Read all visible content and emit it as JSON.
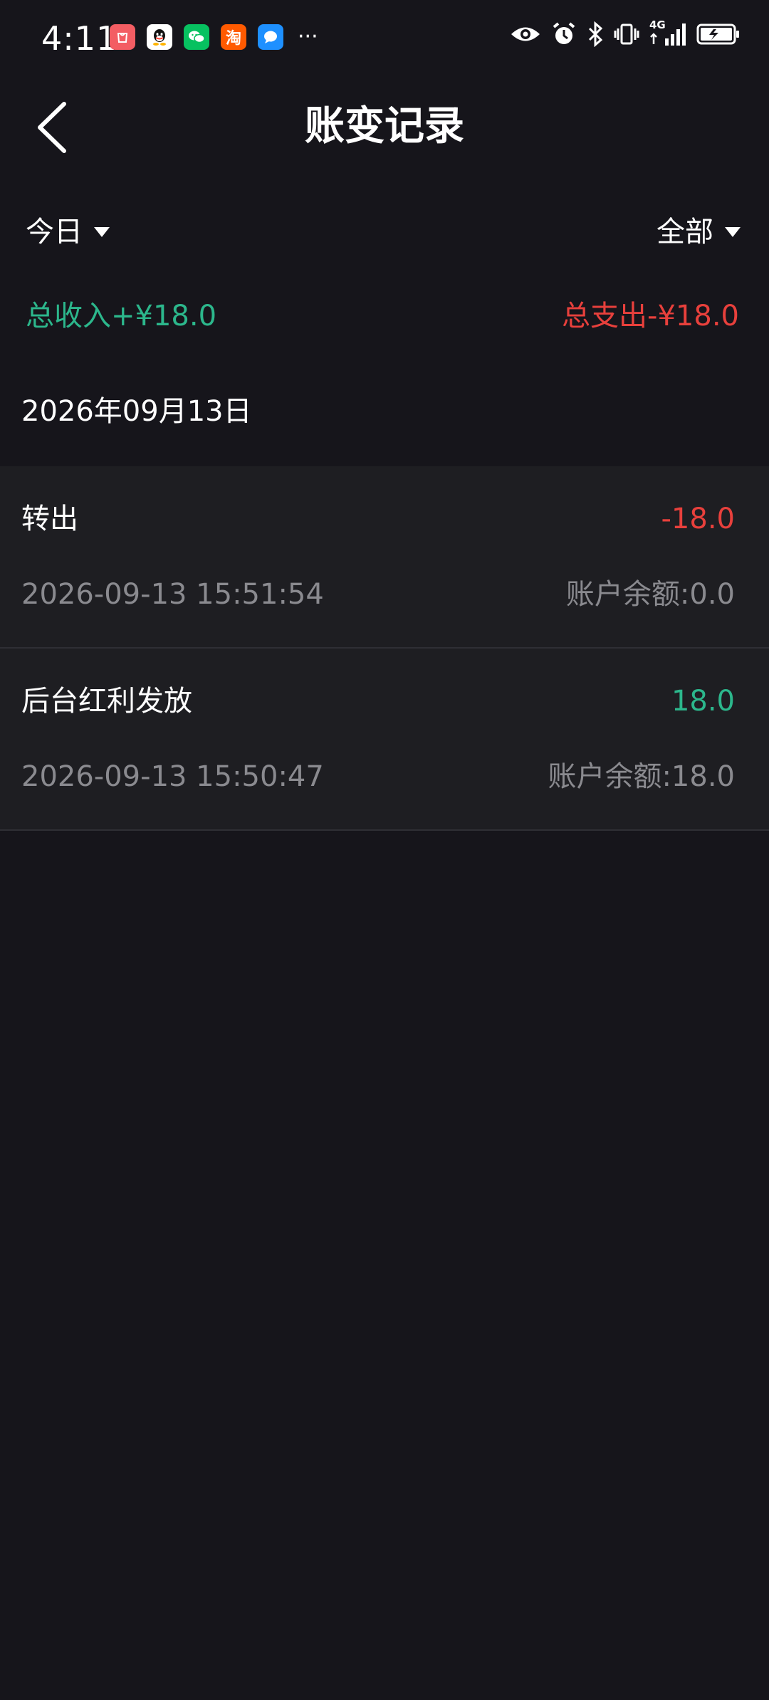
{
  "status_bar": {
    "time": "4:11",
    "notification_icons": [
      {
        "name": "shopping-app-icon",
        "color": "#f35d63",
        "glyph": ""
      },
      {
        "name": "qq-app-icon",
        "color": "#ffffff",
        "glyph": ""
      },
      {
        "name": "wechat-app-icon",
        "color": "#07c160",
        "glyph": ""
      },
      {
        "name": "taobao-app-icon",
        "color": "#ff5a00",
        "glyph": "淘"
      },
      {
        "name": "message-app-icon",
        "color": "#1e90ff",
        "glyph": ""
      }
    ],
    "more_indicator": "···",
    "network_label": "4G"
  },
  "header": {
    "title": "账变记录",
    "back_icon": "chevron-left-icon"
  },
  "filters": {
    "period": "今日",
    "category": "全部"
  },
  "summary": {
    "income": "总收入+¥18.0",
    "expense": "总支出-¥18.0"
  },
  "date_group": "2026年09月13日",
  "records": [
    {
      "title": "转出",
      "amount": "-18.0",
      "time": "2026-09-13 15:51:54",
      "balance": "账户余额:0.0"
    },
    {
      "title": "后台红利发放",
      "amount": "18.0",
      "time": "2026-09-13 15:50:47",
      "balance": "账户余额:18.0"
    }
  ],
  "colors": {
    "background": "#16151b",
    "card": "#1e1e22",
    "income": "#2cb78c",
    "expense": "#e8403c",
    "secondary_text": "#8a8a8f"
  }
}
